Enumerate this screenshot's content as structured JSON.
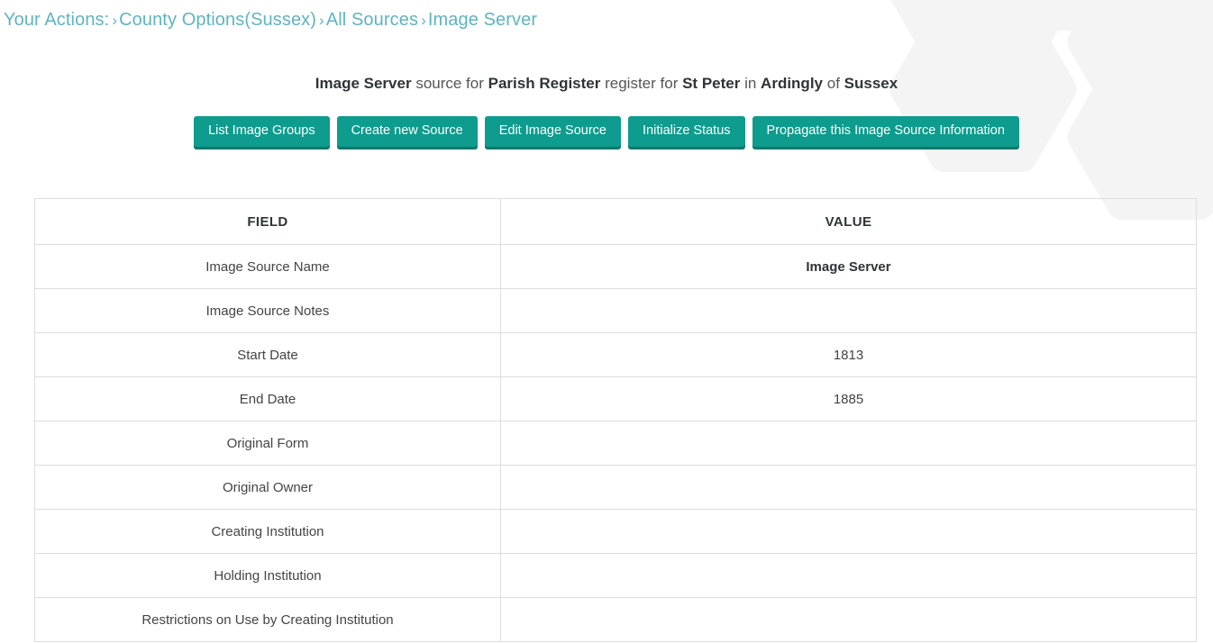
{
  "theme": {
    "accent": "#0d9c8d",
    "accent_shadow": "#06776c",
    "breadcrumb_color": "#5fb4bf",
    "border_color": "#dddddd",
    "watermark_color": "#f4f4f4"
  },
  "breadcrumb": {
    "label": "Your Actions:",
    "separator": "›",
    "items": [
      {
        "label": "County Options(Sussex)"
      },
      {
        "label": "All Sources"
      },
      {
        "label": "Image Server"
      }
    ]
  },
  "title": {
    "source_name": "Image Server",
    "text_source_for": "source for",
    "register_type": "Parish Register",
    "text_register_for": "register for",
    "parish": "St Peter",
    "text_in": "in",
    "place": "Ardingly",
    "text_of": "of",
    "county": "Sussex"
  },
  "toolbar": {
    "buttons": [
      {
        "label": "List Image Groups"
      },
      {
        "label": "Create new Source"
      },
      {
        "label": "Edit Image Source"
      },
      {
        "label": "Initialize Status"
      },
      {
        "label": "Propagate this Image Source Information"
      }
    ]
  },
  "table": {
    "headers": [
      "FIELD",
      "VALUE"
    ],
    "rows": [
      {
        "field": "Image Source Name",
        "value": "Image Server",
        "bold": true
      },
      {
        "field": "Image Source Notes",
        "value": "",
        "bold": false
      },
      {
        "field": "Start Date",
        "value": "1813",
        "bold": false
      },
      {
        "field": "End Date",
        "value": "1885",
        "bold": false
      },
      {
        "field": "Original Form",
        "value": "",
        "bold": false
      },
      {
        "field": "Original Owner",
        "value": "",
        "bold": false
      },
      {
        "field": "Creating Institution",
        "value": "",
        "bold": false
      },
      {
        "field": "Holding Institution",
        "value": "",
        "bold": false
      },
      {
        "field": "Restrictions on Use by Creating Institution",
        "value": "",
        "bold": false
      }
    ]
  }
}
